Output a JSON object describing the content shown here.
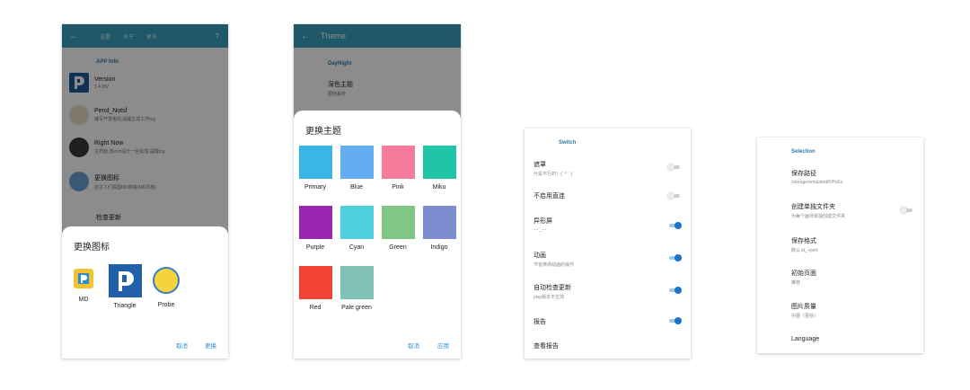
{
  "phone1": {
    "tabs": [
      "设置",
      "关于",
      "更多"
    ],
    "section": "APP Info",
    "items": [
      {
        "title": "Version",
        "subtitle": "1.4.9W"
      },
      {
        "title": "Perol_Notsf",
        "subtitle": "编写开发者组,提醒生成工作ing"
      },
      {
        "title": "Right Now",
        "subtitle": "主界面,选icon设计一些处理,提醒ing"
      },
      {
        "title": "更换图标",
        "subtitle": "自主人们探图MD简易(MD风格)"
      },
      {
        "title": "检查更新",
        "subtitle": ""
      }
    ],
    "dialog": {
      "title": "更换图标",
      "options": [
        "MD",
        "Triangle",
        "Probe"
      ],
      "cancel": "取消",
      "confirm": "更换"
    }
  },
  "phone2": {
    "title": "Theme",
    "section": "DayNight",
    "item": {
      "title": "深色主题",
      "subtitle": "跟随系统"
    },
    "dialog": {
      "title": "更换主题",
      "swatches": [
        {
          "name": "Primary",
          "color": "#3ab5e6"
        },
        {
          "name": "Blue",
          "color": "#63aef2"
        },
        {
          "name": "Pink",
          "color": "#f47b9b"
        },
        {
          "name": "Miku",
          "color": "#22c4a8"
        },
        {
          "name": "Purple",
          "color": "#9b27b0"
        },
        {
          "name": "Cyan",
          "color": "#4fd0e1"
        },
        {
          "name": "Green",
          "color": "#80c783"
        },
        {
          "name": "Indigo",
          "color": "#7e8cd0"
        },
        {
          "name": "Red",
          "color": "#f34336"
        },
        {
          "name": "Pale green",
          "color": "#80c1b8"
        }
      ],
      "cancel": "取消",
      "confirm": "应用"
    }
  },
  "phone3": {
    "section": "Switch",
    "rows": [
      {
        "title": "遮罩",
        "subtitle": "什是不行的！(´ ^ ` )",
        "on": false
      },
      {
        "title": "不启用直连",
        "subtitle": "",
        "on": false
      },
      {
        "title": "异形屏",
        "subtitle": "---:_---",
        "on": true
      },
      {
        "title": "动画",
        "subtitle": "节省换场动画的操作",
        "on": true
      },
      {
        "title": "自动检查更新",
        "subtitle": "play版本不生效",
        "on": true
      },
      {
        "title": "报告",
        "subtitle": "",
        "on": true
      },
      {
        "title": "查看报告",
        "subtitle": ""
      }
    ]
  },
  "phone4": {
    "section": "Selection",
    "rows": [
      {
        "title": "保存路径",
        "subtitle": "/storage/emulated/0/PxEz"
      },
      {
        "title": "创建单独文件夹",
        "subtitle": "为每个画师单独创建文件夹",
        "toggle": false
      },
      {
        "title": "保存格式",
        "subtitle": "默认.kt_+port"
      },
      {
        "title": "初始页面",
        "subtitle": "推荐"
      },
      {
        "title": "图片质量",
        "subtitle": "中图（更快）"
      },
      {
        "title": "Language",
        "subtitle": ""
      }
    ]
  },
  "colors": {
    "accent": "#3aa0bf",
    "link": "#2f8fd8",
    "toggle_on": "#1a73c9"
  }
}
